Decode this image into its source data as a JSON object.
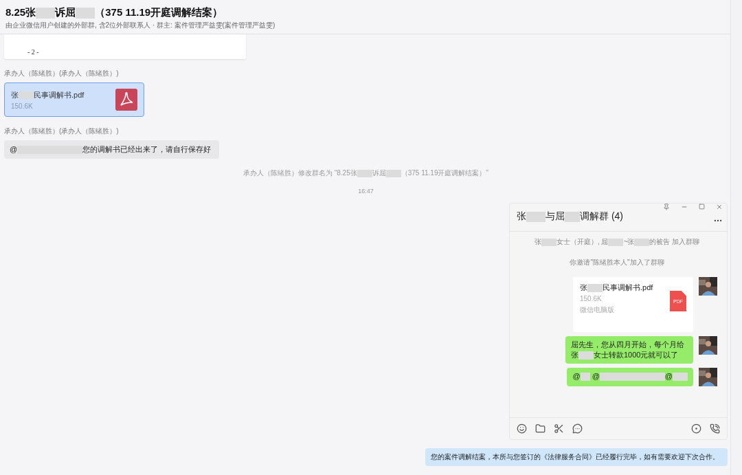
{
  "header": {
    "title": [
      {
        "kind": "text",
        "text": "8.25张"
      },
      {
        "kind": "redacted_medium"
      },
      {
        "kind": "text",
        "text": "诉屈"
      },
      {
        "kind": "redacted_medium"
      },
      {
        "kind": "text",
        "text": "（375  11.19开庭调解结案）"
      }
    ],
    "subtitle": "由企业微信用户创建的外部群, 含2位外部联系人 · 群主: 案件管理严益雯(案件管理严益雯)"
  },
  "messages": [
    {
      "kind": "doc_preview",
      "page_label": "- 2 -"
    },
    {
      "kind": "sender",
      "text": "承办人（陈绪胜）(承办人（陈绪胜）)"
    },
    {
      "kind": "file",
      "selected": true,
      "name": [
        {
          "kind": "text",
          "text": "张"
        },
        {
          "kind": "redacted_short"
        },
        {
          "kind": "text",
          "text": "民事调解书.pdf"
        }
      ],
      "size": "150.6K"
    },
    {
      "kind": "sender",
      "text": "承办人（陈绪胜）(承办人（陈绪胜）)"
    },
    {
      "kind": "bubble",
      "text": [
        {
          "kind": "text",
          "text": "@"
        },
        {
          "kind": "redacted_long"
        },
        {
          "kind": "text",
          "text": "您的调解书已经出来了，请自行保存好"
        }
      ]
    },
    {
      "kind": "system",
      "text": [
        {
          "kind": "text",
          "text": "承办人（陈绪胜）修改群名为 “8.25张"
        },
        {
          "kind": "redacted_short"
        },
        {
          "kind": "text",
          "text": "诉屈"
        },
        {
          "kind": "redacted_short"
        },
        {
          "kind": "text",
          "text": "（375  11.19开庭调解结案）”"
        }
      ]
    },
    {
      "kind": "time",
      "text": "16:47"
    },
    {
      "kind": "screenshot"
    },
    {
      "kind": "notice",
      "text": "您的案件调解结案，本所与您签订的《法律服务合同》已经履行完毕，如有需要欢迎下次合作。"
    }
  ],
  "embedded_window": {
    "title": [
      {
        "kind": "text",
        "text": "张"
      },
      {
        "kind": "redacted_medium"
      },
      {
        "kind": "text",
        "text": "与屈"
      },
      {
        "kind": "redacted_short"
      },
      {
        "kind": "text",
        "text": "调解群 (4)"
      }
    ],
    "messages": [
      {
        "kind": "system",
        "text": [
          {
            "kind": "text",
            "text": "张"
          },
          {
            "kind": "redacted_short"
          },
          {
            "kind": "text",
            "text": "女士（开庭）, 屈"
          },
          {
            "kind": "redacted_short"
          },
          {
            "kind": "text",
            "text": "~张"
          },
          {
            "kind": "redacted_short"
          },
          {
            "kind": "text",
            "text": "的被告 加入群聊"
          }
        ]
      },
      {
        "kind": "system",
        "text": [
          {
            "kind": "text",
            "text": "你邀请\"陈绪胜本人\"加入了群聊"
          }
        ]
      },
      {
        "kind": "file",
        "name": [
          {
            "kind": "text",
            "text": "张"
          },
          {
            "kind": "redacted_short"
          },
          {
            "kind": "text",
            "text": "民事调解书.pdf"
          }
        ],
        "size": "150.6K",
        "source": "微信电脑版",
        "badge": "PDF"
      },
      {
        "kind": "green",
        "text": [
          {
            "kind": "text",
            "text": "屈先生，您从四月开始，每个月给张"
          },
          {
            "kind": "redacted_short"
          },
          {
            "kind": "text",
            "text": "女士转款1000元就可以了"
          }
        ]
      },
      {
        "kind": "green",
        "text": [
          {
            "kind": "text",
            "text": "@"
          },
          {
            "kind": "redacted_tiny"
          },
          {
            "kind": "text",
            "text": " @"
          },
          {
            "kind": "redacted_long"
          },
          {
            "kind": "text",
            "text": "@"
          },
          {
            "kind": "redacted_short"
          }
        ]
      }
    ]
  }
}
